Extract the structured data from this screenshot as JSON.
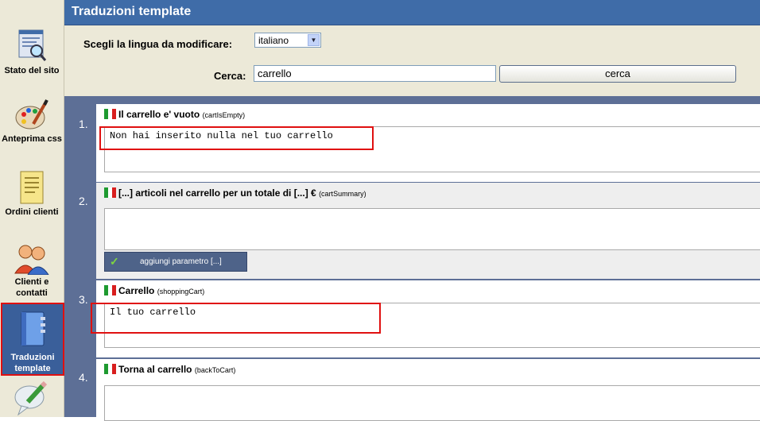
{
  "header": {
    "title": "Traduzioni template"
  },
  "sidebar": {
    "items": [
      {
        "label": "Stato del sito",
        "icon": "site-status-icon"
      },
      {
        "label": "Anteprima css",
        "icon": "palette-icon"
      },
      {
        "label": "Ordini clienti",
        "icon": "orders-icon"
      },
      {
        "label": "Clienti e contatti",
        "icon": "clients-icon"
      },
      {
        "label": "Traduzioni template",
        "icon": "book-icon",
        "active": true
      },
      {
        "label": "",
        "icon": "speech-bubble-pencil-icon"
      }
    ]
  },
  "filter": {
    "language_label": "Scegli la lingua da modificare:",
    "language_value": "italiano",
    "search_label": "Cerca:",
    "search_value": "carrello",
    "search_button": "cerca"
  },
  "entries": [
    {
      "num": "1.",
      "title": "Il carrello e' vuoto",
      "key": "(cartIsEmpty)",
      "value": "Non hai inserito nulla nel tuo carrello"
    },
    {
      "num": "2.",
      "title": "[...] articoli nel carrello per un totale di [...] €",
      "key": "(cartSummary)",
      "value": "",
      "param_button": "aggiungi parametro [...]"
    },
    {
      "num": "3.",
      "title": "Carrello",
      "key": "(shoppingCart)",
      "value": "Il tuo carrello"
    },
    {
      "num": "4.",
      "title": "Torna al carrello",
      "key": "(backToCart)",
      "value": ""
    }
  ],
  "colors": {
    "header_bg": "#3f6ca8",
    "content_bg": "#5d6f96",
    "highlight": "#e01010",
    "sidebar_bg": "#ece9d8"
  }
}
